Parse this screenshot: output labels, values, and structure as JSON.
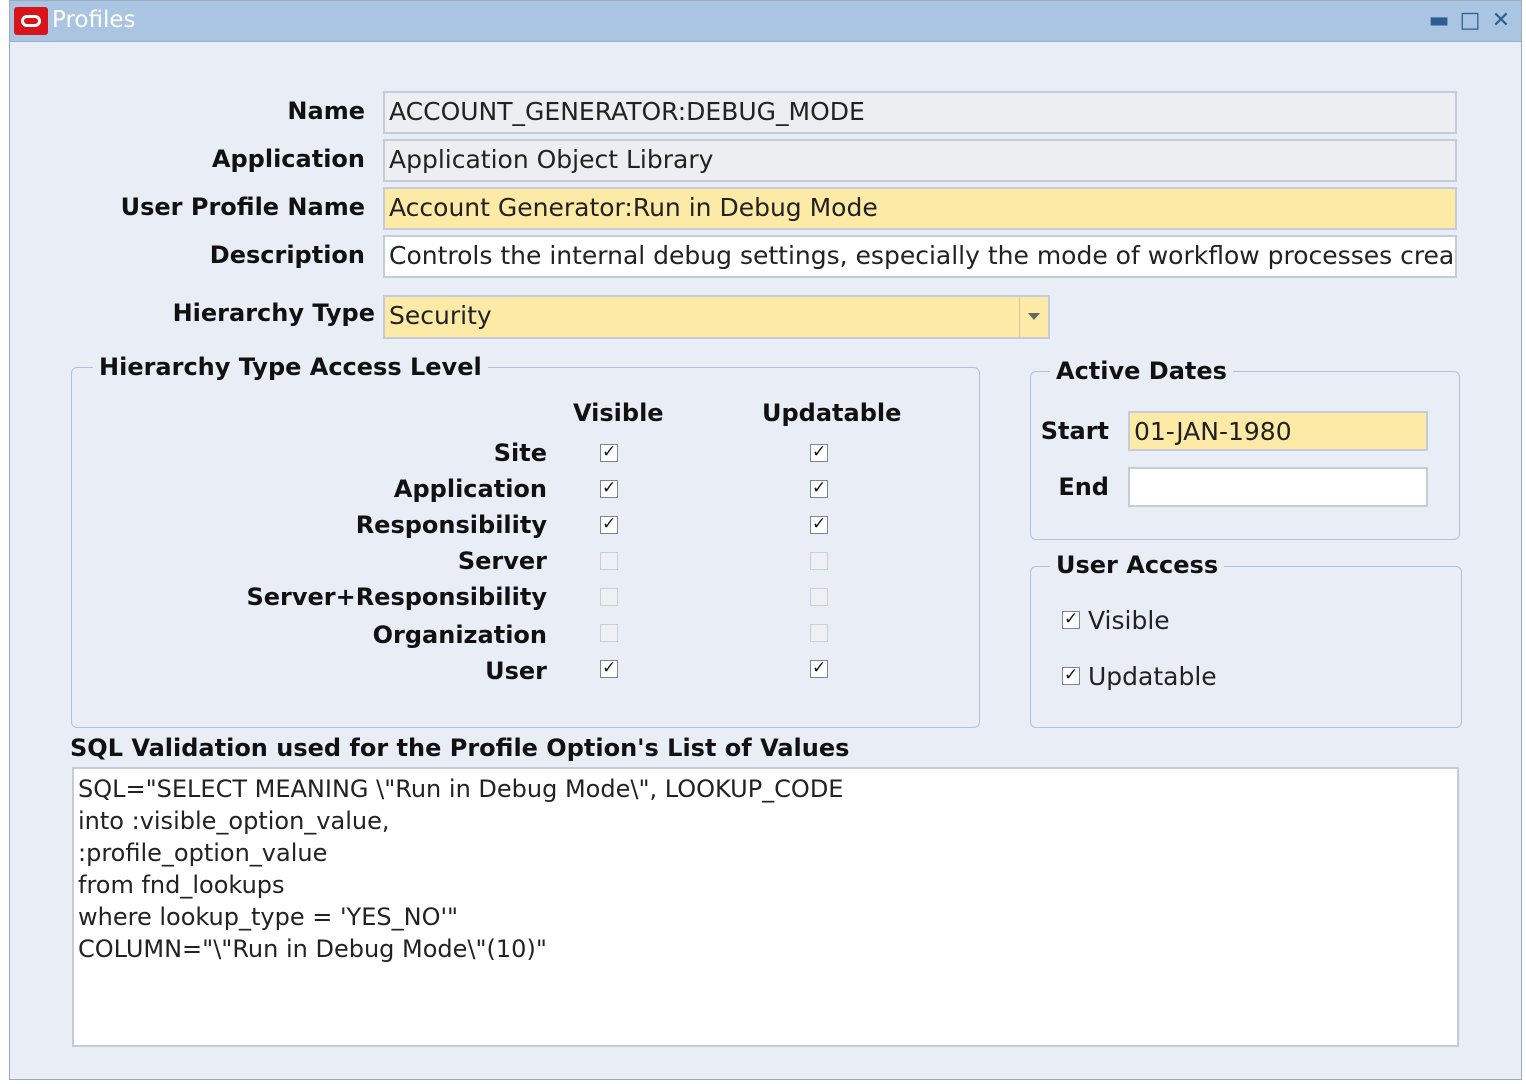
{
  "window": {
    "title": "Profiles"
  },
  "form": {
    "name_label": "Name",
    "name_value": "ACCOUNT_GENERATOR:DEBUG_MODE",
    "application_label": "Application",
    "application_value": "Application Object Library",
    "user_profile_name_label": "User Profile Name",
    "user_profile_name_value": "Account Generator:Run in Debug Mode",
    "description_label": "Description",
    "description_value": "Controls the internal debug settings, especially the mode of workflow processes crea",
    "hierarchy_type_label": "Hierarchy Type",
    "hierarchy_type_value": "Security"
  },
  "access_level": {
    "title": "Hierarchy Type Access Level",
    "visible_header": "Visible",
    "updatable_header": "Updatable",
    "rows": [
      {
        "label": "Site",
        "visible": true,
        "updatable": true
      },
      {
        "label": "Application",
        "visible": true,
        "updatable": true
      },
      {
        "label": "Responsibility",
        "visible": true,
        "updatable": true
      },
      {
        "label": "Server",
        "visible": false,
        "updatable": false
      },
      {
        "label": "Server+Responsibility",
        "visible": false,
        "updatable": false
      },
      {
        "label": "Organization",
        "visible": false,
        "updatable": false
      },
      {
        "label": "User",
        "visible": true,
        "updatable": true
      }
    ]
  },
  "active_dates": {
    "title": "Active Dates",
    "start_label": "Start",
    "start_value": "01-JAN-1980",
    "end_label": "End",
    "end_value": ""
  },
  "user_access": {
    "title": "User Access",
    "visible_label": "Visible",
    "visible_checked": true,
    "updatable_label": "Updatable",
    "updatable_checked": true
  },
  "sql": {
    "label": "SQL Validation used for the Profile Option's List of Values",
    "lines": [
      "SQL=\"SELECT MEANING \\\"Run in Debug Mode\\\", LOOKUP_CODE",
      "into :visible_option_value,",
      ":profile_option_value",
      "from fnd_lookups",
      "where lookup_type = 'YES_NO'\"",
      "COLUMN=\"\\\"Run in Debug Mode\\\"(10)\""
    ]
  }
}
